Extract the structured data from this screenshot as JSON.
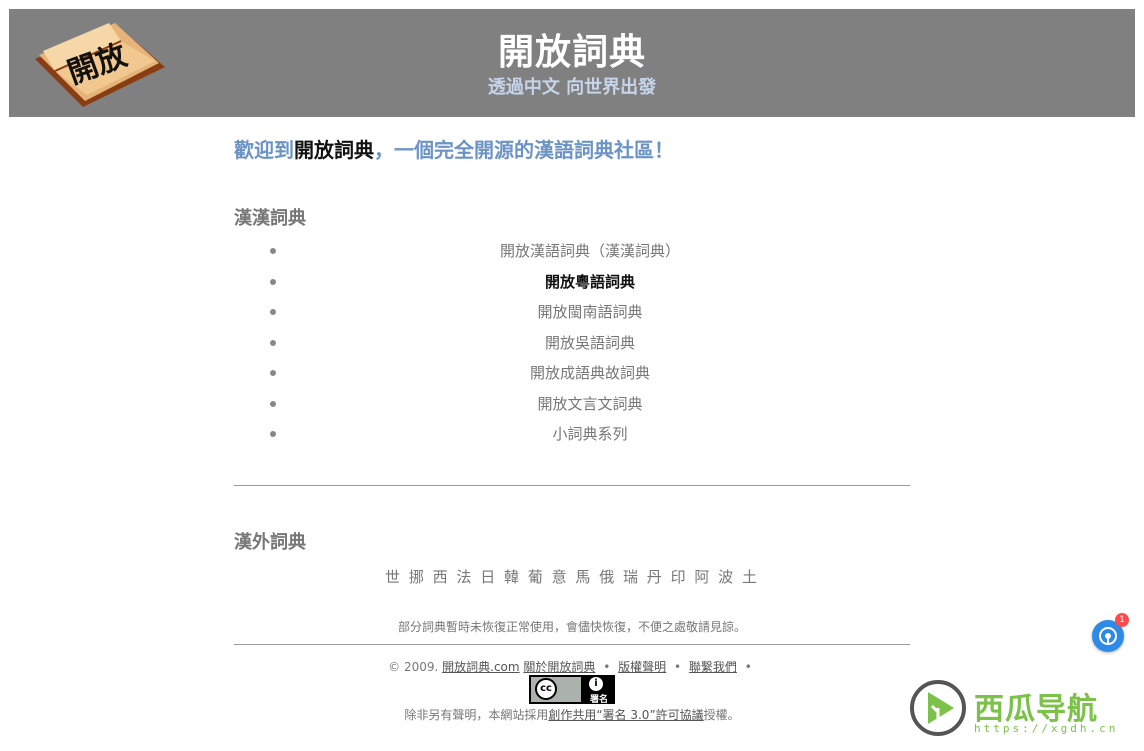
{
  "header": {
    "logo_text": "開放",
    "title": "開放詞典",
    "subtitle": "透過中文 向世界出發"
  },
  "welcome": {
    "prefix": "歡迎到",
    "site_name": "開放詞典",
    "suffix": "，一個完全開源的漢語詞典社區！"
  },
  "sections": {
    "hanhan_title": "漢漢詞典",
    "foreign_title": "漢外詞典"
  },
  "dictionaries": [
    {
      "label": "開放漢語詞典（漢漢詞典）"
    },
    {
      "label": "開放粵語詞典"
    },
    {
      "label": "開放閩南語詞典"
    },
    {
      "label": "開放吳語詞典"
    },
    {
      "label": "開放成語典故詞典"
    },
    {
      "label": "開放文言文詞典"
    },
    {
      "label": "小詞典系列"
    }
  ],
  "foreign_languages": [
    "世",
    "挪",
    "西",
    "法",
    "日",
    "韓",
    "葡",
    "意",
    "馬",
    "俄",
    "瑞",
    "丹",
    "印",
    "阿",
    "波",
    "土"
  ],
  "notice": "部分詞典暫時未恢復正常使用，會儘快恢復，不便之處敬請見諒。",
  "footer": {
    "copyright": "© 2009.",
    "site_link": "開放詞典.com",
    "about_link": "關於開放詞典",
    "copyright_link": "版權聲明",
    "contact_link": "聯繫我們",
    "separator": "•",
    "license_prefix": "除非另有聲明，本網站採用",
    "license_link": "創作共用“署名 3.0”許可協議",
    "license_suffix": "授權。"
  },
  "cc_badge": {
    "cc_text": "cc",
    "by_symbol": "i",
    "by_text": "署名"
  },
  "float_button": {
    "badge_count": "1"
  },
  "watermark": {
    "text": "西瓜导航",
    "url": "https://xgdh.cn"
  },
  "colors": {
    "header_bg": "#808080",
    "accent_blue": "#6b93c5",
    "text_gray": "#777777"
  }
}
